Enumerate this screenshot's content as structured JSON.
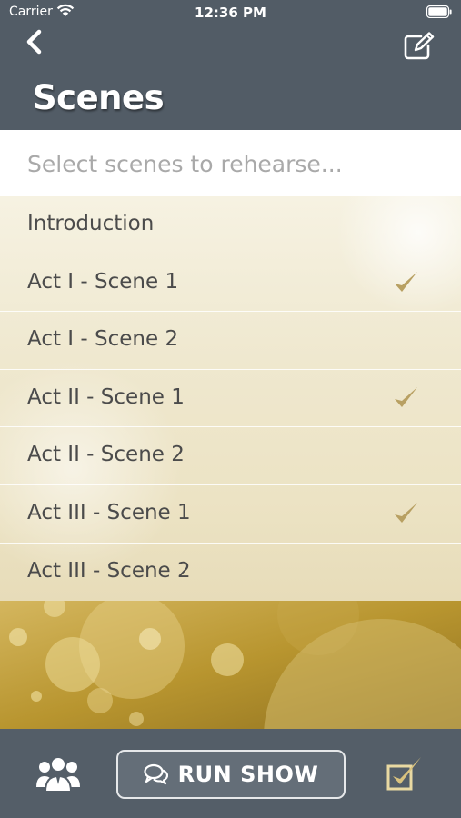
{
  "status_bar": {
    "carrier": "Carrier",
    "time": "12:36 PM"
  },
  "header": {
    "back_icon": "chevron-left-icon",
    "edit_icon": "edit-icon",
    "title": "Scenes"
  },
  "search": {
    "placeholder": "Select scenes to rehearse...",
    "value": ""
  },
  "scenes": [
    {
      "label": "Introduction",
      "selected": false
    },
    {
      "label": "Act I - Scene 1",
      "selected": true
    },
    {
      "label": "Act I - Scene 2",
      "selected": false
    },
    {
      "label": "Act II - Scene 1",
      "selected": true
    },
    {
      "label": "Act II - Scene 2",
      "selected": false
    },
    {
      "label": "Act III - Scene 1",
      "selected": true
    },
    {
      "label": "Act III - Scene 2",
      "selected": false
    }
  ],
  "toolbar": {
    "cast_icon": "cast-group-icon",
    "run_icon": "chat-bubbles-icon",
    "run_label": "RUN SHOW",
    "select_all_icon": "checkbox-check-icon"
  },
  "colors": {
    "header_bg": "#525c66",
    "accent_gold": "#b49a52",
    "check_gold": "#b8a062",
    "toolbar_bg": "#545e68"
  }
}
